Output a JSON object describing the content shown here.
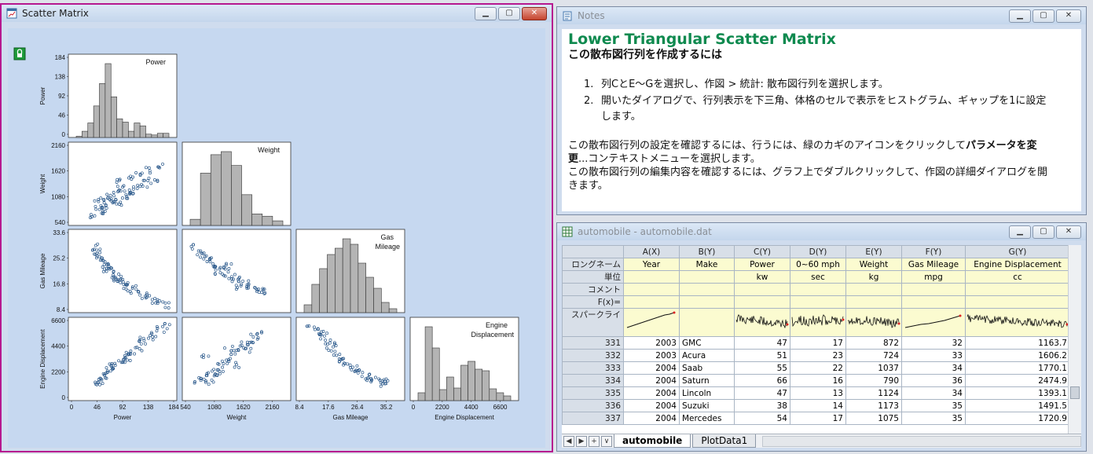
{
  "colors": {
    "accent_title": "#0f8a4f",
    "bar_fill": "#b4b4b4",
    "scatter_point": "#2c5a8c",
    "active_border": "#b6188f"
  },
  "scatter_window": {
    "title": "Scatter Matrix",
    "icon": "graph-window-icon",
    "lock_icon": "green-lock-icon"
  },
  "notes_window": {
    "title": "Notes",
    "heading": "Lower Triangular Scatter Matrix",
    "subheading": "この散布図行列を作成するには",
    "steps": [
      {
        "num": "1.",
        "text": "列CとE～Gを選択し、作図 > 統計: 散布図行列を選択します。"
      },
      {
        "num": "2.",
        "text": "開いたダイアログで、行列表示を下三角、体格のセルで表示をヒストグラム、ギャップを1に設定します。"
      }
    ],
    "para1_pre": "この散布図行列の設定を確認するには、行うには、緑のカギのアイコンをクリックして",
    "para1_bold": "パラメータを変更",
    "para1_post": "...コンテキストメニューを選択します。",
    "para2": "この散布図行列の編集内容を確認するには、グラフ上でダブルクリックして、作図の詳細ダイアログを開きます。"
  },
  "book_window": {
    "title": "automobile - automobile.dat",
    "columns": [
      "A(X)",
      "B(Y)",
      "C(Y)",
      "D(Y)",
      "E(Y)",
      "F(Y)",
      "G(Y)"
    ],
    "meta_labels": [
      "ロングネーム",
      "単位",
      "コメント",
      "F(x)=",
      "スパークライ"
    ],
    "long_names": [
      "Year",
      "Make",
      "Power",
      "0~60 mph",
      "Weight",
      "Gas Mileage",
      "Engine Displacement"
    ],
    "units": [
      "",
      "",
      "kw",
      "sec",
      "kg",
      "mpg",
      "cc"
    ],
    "rows": [
      {
        "idx": "331",
        "cells": [
          "2003",
          "GMC",
          "47",
          "17",
          "872",
          "32",
          "1163.7"
        ]
      },
      {
        "idx": "332",
        "cells": [
          "2003",
          "Acura",
          "51",
          "23",
          "724",
          "33",
          "1606.2"
        ]
      },
      {
        "idx": "333",
        "cells": [
          "2004",
          "Saab",
          "55",
          "22",
          "1037",
          "34",
          "1770.1"
        ]
      },
      {
        "idx": "334",
        "cells": [
          "2004",
          "Saturn",
          "66",
          "16",
          "790",
          "36",
          "2474.9"
        ]
      },
      {
        "idx": "335",
        "cells": [
          "2004",
          "Lincoln",
          "47",
          "13",
          "1124",
          "34",
          "1393.1"
        ]
      },
      {
        "idx": "336",
        "cells": [
          "2004",
          "Suzuki",
          "38",
          "14",
          "1173",
          "35",
          "1491.5"
        ]
      },
      {
        "idx": "337",
        "cells": [
          "2004",
          "Mercedes",
          "54",
          "17",
          "1075",
          "35",
          "1720.9"
        ]
      }
    ],
    "tabs": [
      {
        "label": "automobile",
        "active": true
      },
      {
        "label": "PlotData1",
        "active": false
      }
    ]
  },
  "chart_data": [
    {
      "type": "bar",
      "title": "Power",
      "xlim": [
        0,
        184
      ],
      "ylim": [
        0,
        184
      ],
      "yticks": [
        "184",
        "138",
        "92",
        "46",
        "0"
      ],
      "ylabel": "Power",
      "values": [
        3,
        15,
        35,
        76,
        130,
        178,
        98,
        45,
        37,
        15,
        35,
        28,
        8,
        6,
        10,
        10
      ]
    },
    {
      "type": "bar",
      "title": "Weight",
      "xlim": [
        540,
        2700
      ],
      "xticks": [
        "540",
        "1080",
        "1620",
        "2160"
      ],
      "xlabel": "Weight",
      "values": [
        0.08,
        0.68,
        0.92,
        0.96,
        0.78,
        0.4,
        0.15,
        0.12,
        0.06
      ]
    },
    {
      "type": "bar",
      "title": "Gas Mileage",
      "xlim": [
        8.4,
        44
      ],
      "xticks": [
        "8.4",
        "17.6",
        "26.4",
        "35.2"
      ],
      "xlabel": "Gas Mileage",
      "values": [
        0.1,
        0.36,
        0.56,
        0.74,
        0.82,
        0.94,
        0.87,
        0.63,
        0.45,
        0.31,
        0.13,
        0.05
      ]
    },
    {
      "type": "bar",
      "title": "Engine Displacement",
      "xlim": [
        0,
        7000
      ],
      "xticks": [
        "0",
        "2200",
        "4400",
        "6600"
      ],
      "xlabel": "Engine Displacement",
      "values": [
        0.1,
        0.94,
        0.67,
        0.14,
        0.3,
        0.16,
        0.45,
        0.5,
        0.4,
        0.38,
        0.15,
        0.1,
        0.06
      ]
    },
    {
      "type": "scatter",
      "x_name": "Power",
      "y_name": "Weight",
      "yticks": [
        "2160",
        "1620",
        "1080",
        "540"
      ],
      "ylabel": "Weight",
      "points": [
        [
          46,
          1200
        ],
        [
          60,
          1000
        ],
        [
          70,
          1300
        ],
        [
          75,
          1100
        ],
        [
          90,
          1500
        ],
        [
          100,
          1400
        ],
        [
          50,
          900
        ],
        [
          80,
          1700
        ],
        [
          110,
          1800
        ],
        [
          130,
          1600
        ],
        [
          55,
          800
        ],
        [
          65,
          1150
        ],
        [
          95,
          1250
        ],
        [
          120,
          1900
        ],
        [
          140,
          2000
        ],
        [
          150,
          1700
        ],
        [
          40,
          700
        ],
        [
          85,
          1050
        ],
        [
          105,
          1350
        ],
        [
          115,
          1550
        ],
        [
          135,
          1750
        ],
        [
          160,
          2100
        ],
        [
          58,
          1020
        ],
        [
          72,
          1180
        ],
        [
          88,
          1420
        ]
      ]
    },
    {
      "type": "scatter",
      "x_name": "Power",
      "y_name": "Gas Mileage",
      "yticks": [
        "33.6",
        "25.2",
        "16.8",
        "8.4"
      ],
      "ylabel": "Gas Mileage",
      "points": [
        [
          40,
          34
        ],
        [
          45,
          32
        ],
        [
          50,
          30
        ],
        [
          55,
          28
        ],
        [
          60,
          27
        ],
        [
          65,
          25
        ],
        [
          70,
          24
        ],
        [
          75,
          22
        ],
        [
          80,
          21
        ],
        [
          90,
          20
        ],
        [
          100,
          18
        ],
        [
          110,
          17
        ],
        [
          120,
          15
        ],
        [
          130,
          14
        ],
        [
          140,
          13
        ],
        [
          150,
          12
        ],
        [
          160,
          11
        ],
        [
          170,
          10
        ],
        [
          48,
          31
        ],
        [
          62,
          26
        ],
        [
          85,
          22
        ],
        [
          95,
          19
        ],
        [
          105,
          16
        ]
      ]
    },
    {
      "type": "scatter",
      "x_name": "Weight",
      "y_name": "Gas Mileage",
      "points": [
        [
          700,
          34
        ],
        [
          800,
          32
        ],
        [
          900,
          31
        ],
        [
          1000,
          29
        ],
        [
          1100,
          27
        ],
        [
          1200,
          26
        ],
        [
          1300,
          25
        ],
        [
          1400,
          23
        ],
        [
          1500,
          22
        ],
        [
          1600,
          21
        ],
        [
          1700,
          20
        ],
        [
          1800,
          19
        ],
        [
          1900,
          18
        ],
        [
          2000,
          17
        ],
        [
          2100,
          16
        ],
        [
          2200,
          16
        ],
        [
          1050,
          30
        ],
        [
          1250,
          24
        ],
        [
          1450,
          26
        ],
        [
          1650,
          18
        ]
      ]
    },
    {
      "type": "scatter",
      "x_name": "Power",
      "y_name": "Engine Displacement",
      "yticks": [
        "6600",
        "4400",
        "2200",
        "0"
      ],
      "ylabel": "Engine Displacement",
      "xticks": [
        "0",
        "46",
        "92",
        "138",
        "184"
      ],
      "xlabel": "Power",
      "points": [
        [
          46,
          1500
        ],
        [
          55,
          1800
        ],
        [
          60,
          2000
        ],
        [
          65,
          2300
        ],
        [
          70,
          2500
        ],
        [
          80,
          2800
        ],
        [
          90,
          3200
        ],
        [
          100,
          3600
        ],
        [
          110,
          4000
        ],
        [
          120,
          4500
        ],
        [
          130,
          5000
        ],
        [
          140,
          5500
        ],
        [
          150,
          5800
        ],
        [
          160,
          6200
        ],
        [
          170,
          6500
        ],
        [
          50,
          1300
        ],
        [
          75,
          3000
        ],
        [
          95,
          3300
        ],
        [
          105,
          3900
        ],
        [
          125,
          5200
        ]
      ]
    },
    {
      "type": "scatter",
      "x_name": "Weight",
      "y_name": "Engine Displacement",
      "points": [
        [
          800,
          1500
        ],
        [
          900,
          1700
        ],
        [
          1000,
          2000
        ],
        [
          1100,
          2200
        ],
        [
          1200,
          2500
        ],
        [
          1300,
          3000
        ],
        [
          1400,
          3300
        ],
        [
          1500,
          3700
        ],
        [
          1600,
          4200
        ],
        [
          1700,
          4600
        ],
        [
          1800,
          5000
        ],
        [
          1900,
          5200
        ],
        [
          2000,
          5500
        ],
        [
          2100,
          5800
        ],
        [
          1050,
          1400
        ],
        [
          1250,
          2200
        ],
        [
          1450,
          4500
        ],
        [
          1650,
          3000
        ],
        [
          1850,
          4200
        ],
        [
          950,
          3800
        ]
      ]
    },
    {
      "type": "scatter",
      "x_name": "Gas Mileage",
      "y_name": "Engine Displacement",
      "points": [
        [
          12,
          6500
        ],
        [
          14,
          6000
        ],
        [
          15,
          5500
        ],
        [
          17,
          5000
        ],
        [
          18,
          4400
        ],
        [
          20,
          4000
        ],
        [
          21,
          3500
        ],
        [
          23,
          3000
        ],
        [
          25,
          2600
        ],
        [
          27,
          2200
        ],
        [
          29,
          1900
        ],
        [
          31,
          1700
        ],
        [
          33,
          1500
        ],
        [
          35,
          1400
        ],
        [
          16,
          5800
        ],
        [
          19,
          4800
        ],
        [
          22,
          3300
        ],
        [
          26,
          2400
        ],
        [
          30,
          1800
        ],
        [
          34,
          1300
        ]
      ]
    }
  ]
}
